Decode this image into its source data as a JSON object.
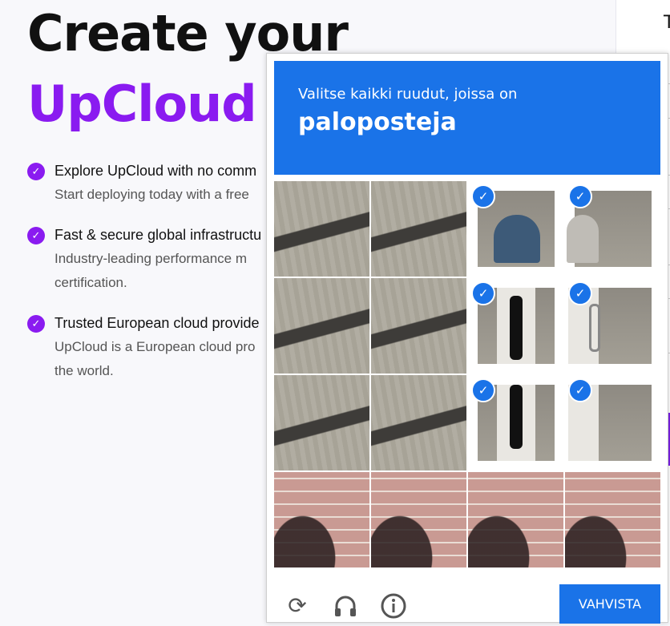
{
  "page": {
    "title_line1": "Create your",
    "title_line2": "UpCloud a",
    "benefits": [
      {
        "title": "Explore UpCloud with no comm",
        "desc_lines": [
          "Start deploying today with a free"
        ]
      },
      {
        "title": "Fast & secure global infrastructu",
        "desc_lines": [
          "Industry-leading performance m",
          "certification."
        ]
      },
      {
        "title": "Trusted European cloud provide",
        "desc_lines": [
          "UpCloud is a European cloud pro",
          "the world."
        ]
      }
    ],
    "right_edge_letter": "T"
  },
  "captcha": {
    "instruction": "Valitse kaikki ruudut, joissa on",
    "keyword": "paloposteja",
    "header_color": "#1a73e8",
    "tiles": [
      {
        "row": 1,
        "col": 1,
        "selected": false
      },
      {
        "row": 1,
        "col": 2,
        "selected": false
      },
      {
        "row": 1,
        "col": 3,
        "selected": true
      },
      {
        "row": 1,
        "col": 4,
        "selected": true
      },
      {
        "row": 2,
        "col": 1,
        "selected": false
      },
      {
        "row": 2,
        "col": 2,
        "selected": false
      },
      {
        "row": 2,
        "col": 3,
        "selected": true
      },
      {
        "row": 2,
        "col": 4,
        "selected": true
      },
      {
        "row": 3,
        "col": 1,
        "selected": false
      },
      {
        "row": 3,
        "col": 2,
        "selected": false
      },
      {
        "row": 3,
        "col": 3,
        "selected": true
      },
      {
        "row": 3,
        "col": 4,
        "selected": true
      },
      {
        "row": 4,
        "col": 1,
        "selected": false
      },
      {
        "row": 4,
        "col": 2,
        "selected": false
      },
      {
        "row": 4,
        "col": 3,
        "selected": false
      },
      {
        "row": 4,
        "col": 4,
        "selected": false
      }
    ],
    "footer_icons": [
      "reload-icon",
      "headphones-icon",
      "info-icon"
    ],
    "verify_label": "VAHVISTA"
  }
}
